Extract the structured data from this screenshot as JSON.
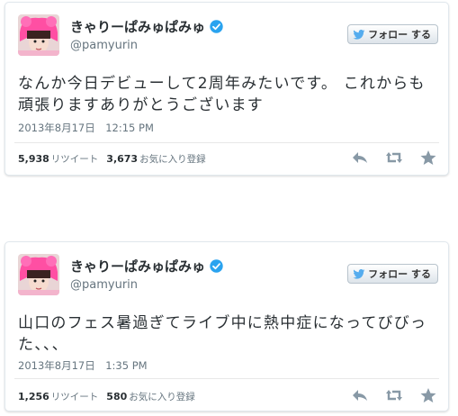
{
  "colors": {
    "verified_badge": "#2aa3ef",
    "twitter_bird": "#55acee",
    "text_primary": "#292f33",
    "text_secondary": "#66757f",
    "action_icon": "#8899a6"
  },
  "tweets": [
    {
      "display_name": "きゃりーぱみゅぱみゅ",
      "screen_name": "@pamyurin",
      "follow_label": "フォロー する",
      "text": "なんか今日デビューして2周年みたいです。 これからも頑張りますありがとうございます",
      "timestamp": "2013年8月17日　12:15 PM",
      "retweets_count": "5,938",
      "retweets_label": "リツイート",
      "favorites_count": "3,673",
      "favorites_label": "お気に入り登録",
      "icons": [
        "verified-icon",
        "twitter-bird-icon",
        "reply-icon",
        "retweet-icon",
        "favorite-star-icon"
      ]
    },
    {
      "display_name": "きゃりーぱみゅぱみゅ",
      "screen_name": "@pamyurin",
      "follow_label": "フォロー する",
      "text": "山口のフェス暑過ぎてライブ中に熱中症になってびびった、、、",
      "timestamp": "2013年8月17日　1:35 PM",
      "retweets_count": "1,256",
      "retweets_label": "リツイート",
      "favorites_count": "580",
      "favorites_label": "お気に入り登録",
      "icons": [
        "verified-icon",
        "twitter-bird-icon",
        "reply-icon",
        "retweet-icon",
        "favorite-star-icon"
      ]
    }
  ]
}
